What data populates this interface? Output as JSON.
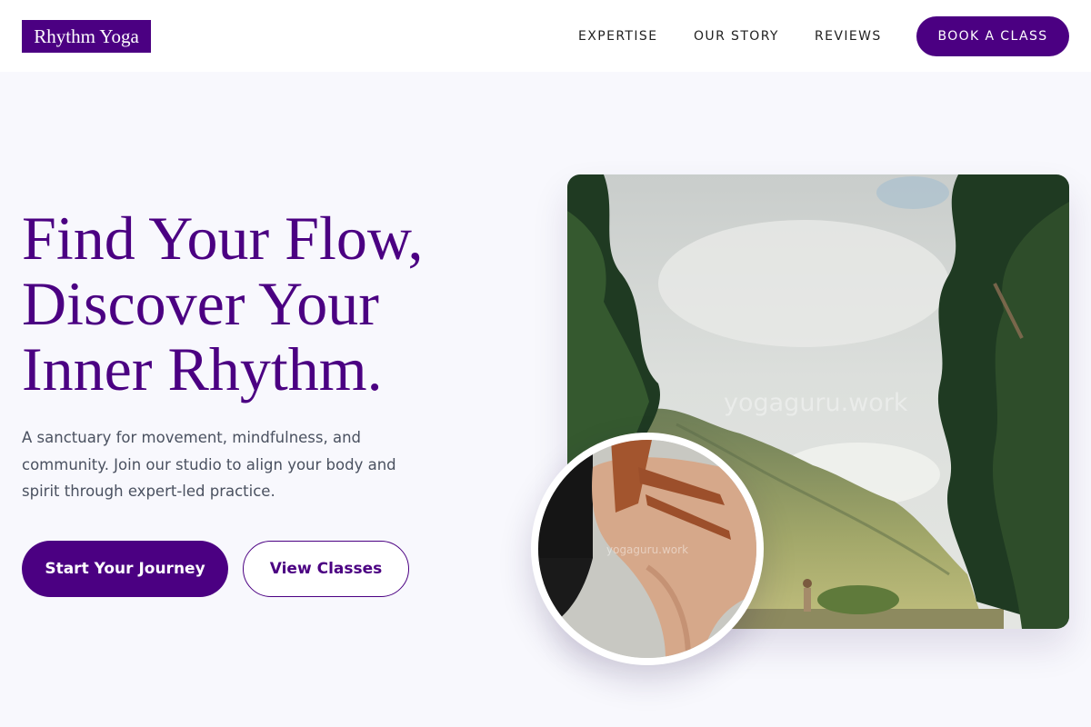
{
  "brand": {
    "logo_text": "Rhythm Yoga",
    "primary_color": "#4b0082"
  },
  "nav": {
    "items": [
      {
        "label": "EXPERTISE"
      },
      {
        "label": "OUR STORY"
      },
      {
        "label": "REVIEWS"
      }
    ],
    "cta_label": "BOOK A CLASS"
  },
  "hero": {
    "headline_lines": [
      "Find Your Flow,",
      "Discover Your",
      "Inner Rhythm."
    ],
    "subtext": "A sanctuary for movement, mindfulness, and community. Join our studio to align your body and spirit through expert-led practice.",
    "primary_button": "Start Your Journey",
    "secondary_button": "View Classes"
  },
  "images": {
    "main_watermark": "yogaguru.work",
    "circle_watermark": "yogaguru.work"
  }
}
